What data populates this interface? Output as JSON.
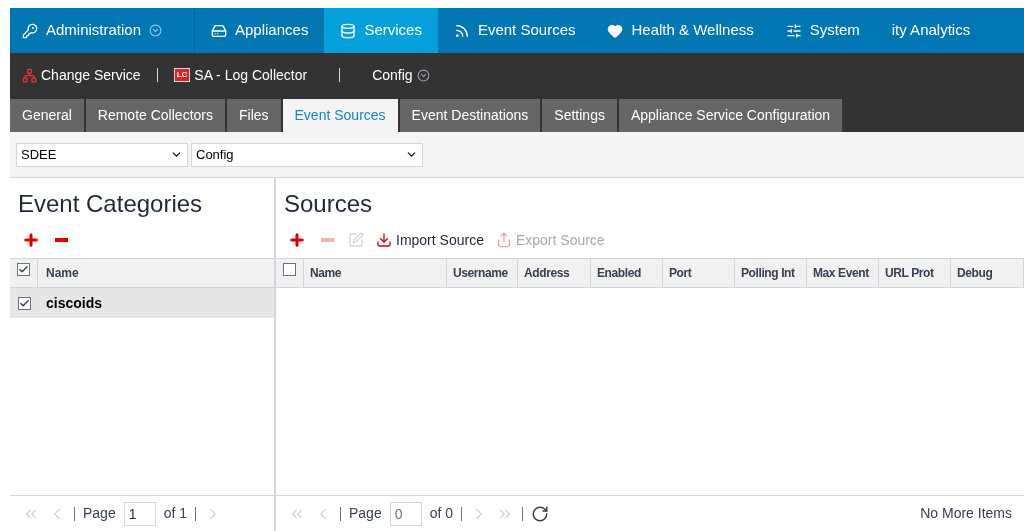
{
  "nav": [
    {
      "label": "Administration",
      "dropdown": true,
      "selected": false
    },
    {
      "label": "Appliances",
      "dropdown": false,
      "selected": false
    },
    {
      "label": "Services",
      "dropdown": false,
      "selected": true
    },
    {
      "label": "Event Sources",
      "dropdown": false,
      "selected": false
    },
    {
      "label": "Health & Wellness",
      "dropdown": false,
      "selected": false
    },
    {
      "label": "System",
      "dropdown": false,
      "selected": false
    },
    {
      "label": "ity Analytics",
      "dropdown": false,
      "selected": false
    }
  ],
  "service_bar": {
    "change_service": "Change Service",
    "badge": "LC",
    "service": "SA - Log Collector",
    "view": "Config"
  },
  "tabs": [
    {
      "label": "General",
      "selected": false
    },
    {
      "label": "Remote Collectors",
      "selected": false
    },
    {
      "label": "Files",
      "selected": false
    },
    {
      "label": "Event Sources",
      "selected": true
    },
    {
      "label": "Event Destinations",
      "selected": false
    },
    {
      "label": "Settings",
      "selected": false
    },
    {
      "label": "Appliance Service Configuration",
      "selected": false
    }
  ],
  "filters": {
    "type": "SDEE",
    "mode": "Config"
  },
  "categories": {
    "title": "Event Categories",
    "toolbar": [
      {
        "kind": "add",
        "disabled": false
      },
      {
        "kind": "remove",
        "disabled": false
      }
    ],
    "header": {
      "checked": true,
      "column": "Name"
    },
    "rows": [
      {
        "name": "ciscoids",
        "checked": true,
        "selected": true
      }
    ],
    "pager": {
      "page_label": "Page",
      "page": "1",
      "of": "of 1"
    }
  },
  "sources": {
    "title": "Sources",
    "toolbar": [
      {
        "kind": "add",
        "disabled": false
      },
      {
        "kind": "remove",
        "disabled": true
      },
      {
        "kind": "edit",
        "disabled": true
      },
      {
        "kind": "import",
        "label": "Import Source",
        "disabled": false
      },
      {
        "kind": "export",
        "label": "Export Source",
        "disabled": true
      }
    ],
    "header_checked": false,
    "columns": [
      "Name",
      "Username",
      "Address",
      "Enabled",
      "Port",
      "Polling Int",
      "Max Event",
      "URL Prot",
      "Debug"
    ],
    "pager": {
      "page_label": "Page",
      "page": "0",
      "of": "of 0",
      "status": "No More Items"
    }
  }
}
